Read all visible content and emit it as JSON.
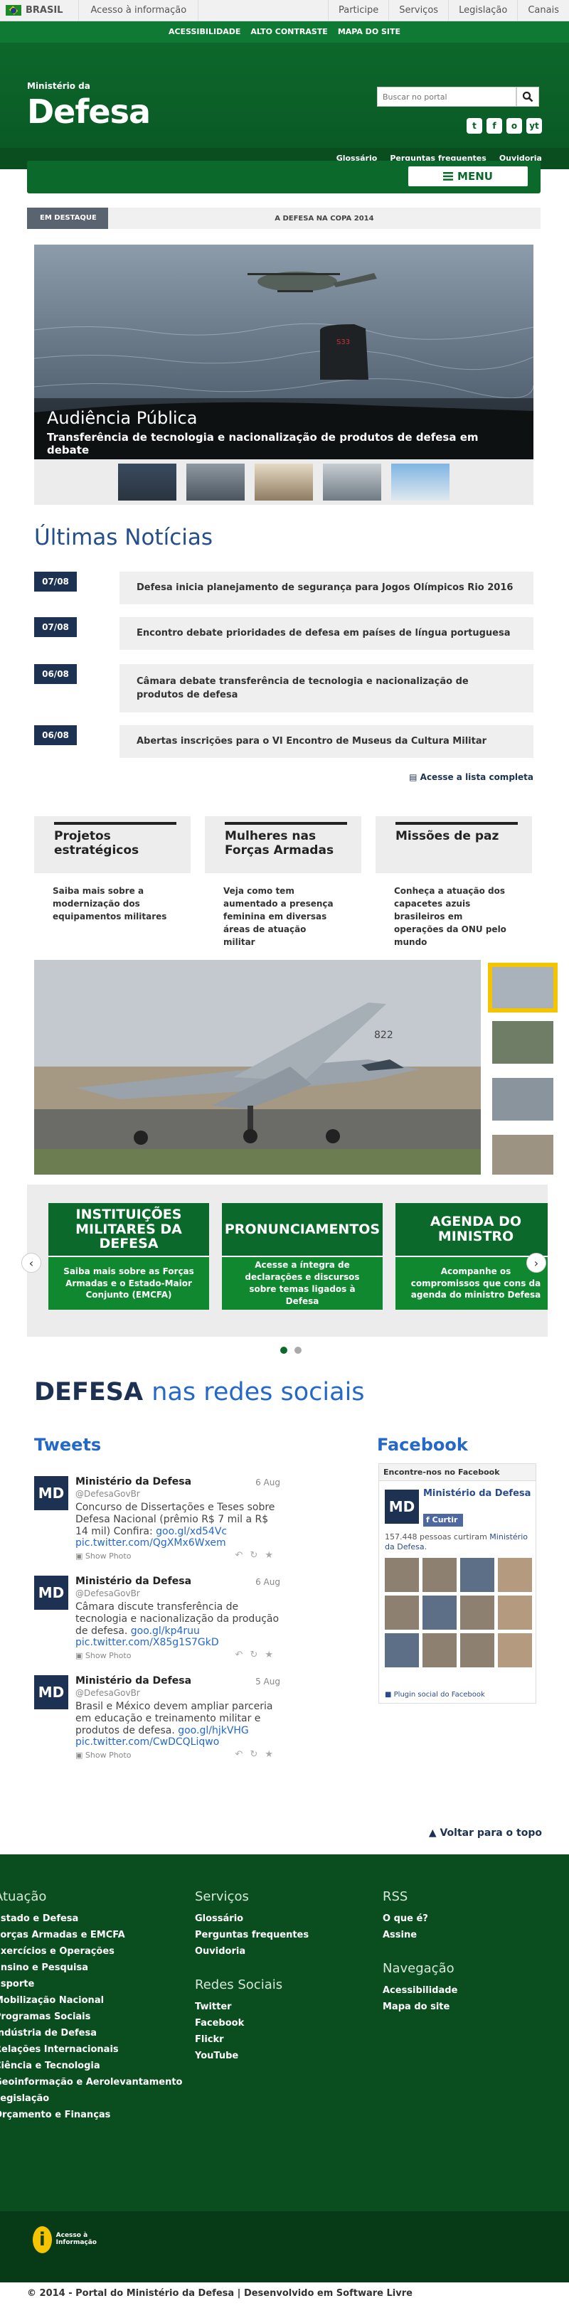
{
  "gov_bar": {
    "country": "BRASIL",
    "access": "Acesso à informação",
    "links": [
      "Participe",
      "Serviços",
      "Legislação",
      "Canais"
    ]
  },
  "top_menu": [
    "ACESSIBILIDADE",
    "ALTO CONTRASTE",
    "MAPA DO SITE"
  ],
  "header": {
    "org": "Ministério da",
    "site_name": "Defesa",
    "search_placeholder": "Buscar no portal",
    "social": [
      "t",
      "f",
      "o",
      "yt"
    ]
  },
  "subnav": [
    "Glossário",
    "Perguntas frequentes",
    "Ouvidoria"
  ],
  "menu": {
    "label": "MENU"
  },
  "highlight": {
    "tag": "EM DESTAQUE",
    "text": "A DEFESA NA COPA 2014"
  },
  "slider": {
    "title": "Audiência Pública",
    "subtitle": "Transferência de tecnologia e nacionalização de produtos de defesa em debate"
  },
  "news": {
    "title": "Últimas Notícias",
    "items": [
      {
        "date": "07/08",
        "title": "Defesa inicia planejamento de segurança para Jogos Olímpicos Rio 2016"
      },
      {
        "date": "07/08",
        "title": "Encontro debate prioridades de defesa em países de língua portuguesa"
      },
      {
        "date": "06/08",
        "title": "Câmara debate transferência de tecnologia e nacionalização de produtos de defesa"
      },
      {
        "date": "06/08",
        "title": "Abertas inscrições para o VI Encontro de Museus da Cultura Militar"
      }
    ],
    "more": "Acesse a lista completa"
  },
  "promos": [
    {
      "title": "Projetos estratégicos",
      "text": "Saiba mais sobre a modernização dos equipamentos militares"
    },
    {
      "title": "Mulheres nas Forças Armadas",
      "text": "Veja como tem aumentado a presença feminina em diversas áreas de atuação militar"
    },
    {
      "title": "Missões de paz",
      "text": "Conheça a atuação dos capacetes azuis brasileiros em operações da ONU pelo mundo"
    }
  ],
  "institutional": [
    {
      "title": "INSTITUIÇÕES MILITARES DA DEFESA",
      "text": "Saiba mais sobre as Forças Armadas e o Estado-Maior Conjunto (EMCFA)"
    },
    {
      "title": "PRONUNCIAMENTOS",
      "text": "Acesse a íntegra de declarações e discursos sobre temas ligados à Defesa"
    },
    {
      "title": "AGENDA DO MINISTRO",
      "text": "Acompanhe os compromissos que cons da agenda do ministro Defesa"
    }
  ],
  "social": {
    "title_a": "DEFESA",
    "title_b": "nas redes sociais",
    "tweets_label": "Tweets",
    "facebook_label": "Facebook",
    "tweets": [
      {
        "avatar": "MD",
        "name": "Ministério da Defesa",
        "handle": "@DefesaGovBr",
        "date": "6 Aug",
        "text": "Concurso de Dissertações e Teses sobre Defesa Nacional (prêmio R$ 7 mil a R$ 14 mil) Confira:",
        "links": "goo.gl/xd54Vc pic.twitter.com/QgXMx6Wxem",
        "photo": "Show Photo"
      },
      {
        "avatar": "MD",
        "name": "Ministério da Defesa",
        "handle": "@DefesaGovBr",
        "date": "6 Aug",
        "text": "Câmara discute transferência de tecnologia e nacionalização da produção de defesa.",
        "links": "goo.gl/kp4ruu pic.twitter.com/X85g1S7GkD",
        "photo": "Show Photo"
      },
      {
        "avatar": "MD",
        "name": "Ministério da Defesa",
        "handle": "@DefesaGovBr",
        "date": "5 Aug",
        "text": "Brasil e México devem ampliar parceria em educação e treinamento militar e produtos de defesa.",
        "links": "goo.gl/hjkVHG pic.twitter.com/CwDCQLiqwo",
        "photo": "Show Photo"
      }
    ],
    "facebook": {
      "header": "Encontre-nos no Facebook",
      "avatar": "MD",
      "page": "Ministério da Defesa",
      "like": "Curtir",
      "count_text": "157.448 pessoas curtiram",
      "count_link": "Ministério da Defesa.",
      "plugin": "Plugin social do Facebook"
    }
  },
  "back_to_top": "Voltar para o topo",
  "footer": {
    "atuacao": {
      "title": "Atuação",
      "items": [
        "Estado e Defesa",
        "Forças Armadas e EMCFA",
        "Exercícios e Operações",
        "Ensino e Pesquisa",
        "Esporte",
        "Mobilização Nacional",
        "Programas Sociais",
        "Indústria de Defesa",
        "Relações Internacionais",
        "Ciência e Tecnologia",
        "Geoinformação e Aerolevantamento",
        "Legislação",
        "Orçamento e Finanças"
      ]
    },
    "servicos": {
      "title": "Serviços",
      "items": [
        "Glossário",
        "Perguntas frequentes",
        "Ouvidoria"
      ]
    },
    "redes": {
      "title": "Redes Sociais",
      "items": [
        "Twitter",
        "Facebook",
        "Flickr",
        "YouTube"
      ]
    },
    "rss": {
      "title": "RSS",
      "items": [
        "O que é?",
        "Assine"
      ]
    },
    "navegacao": {
      "title": "Navegação",
      "items": [
        "Acessibilidade",
        "Mapa do site"
      ]
    }
  },
  "access_info_logo": {
    "line1": "Acesso à",
    "line2": "Informação"
  },
  "copyright": "© 2014 - Portal do Ministério da Defesa | Desenvolvido em Software Livre",
  "colors": {
    "brand_green": "#0b6a2b",
    "navy": "#1d3252",
    "link_blue": "#2468c9",
    "highlight_yellow": "#f4c400"
  }
}
